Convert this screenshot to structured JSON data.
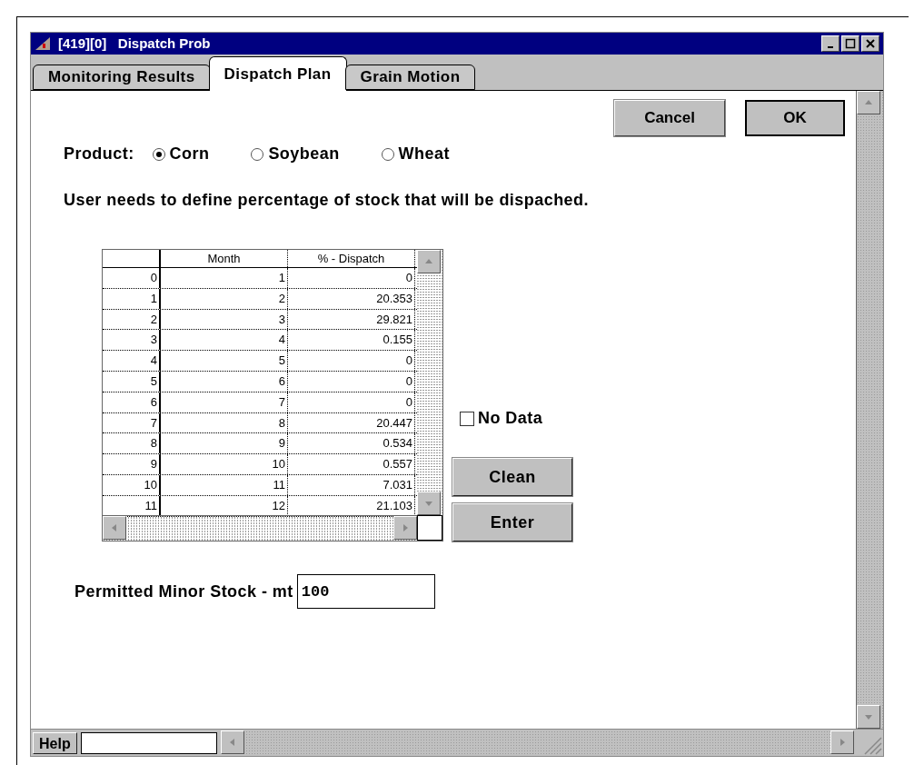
{
  "window": {
    "title": "[419][0]   Dispatch Prob"
  },
  "tabs": [
    {
      "label": "Monitoring Results",
      "selected": false
    },
    {
      "label": "Dispatch Plan",
      "selected": true
    },
    {
      "label": "Grain Motion",
      "selected": false
    }
  ],
  "top_buttons": [
    {
      "label": "Cancel",
      "default": false
    },
    {
      "label": "OK",
      "default": true
    }
  ],
  "product": {
    "label": "Product:",
    "options": [
      {
        "label": "Corn",
        "selected": true
      },
      {
        "label": "Soybean",
        "selected": false
      },
      {
        "label": "Wheat",
        "selected": false
      }
    ]
  },
  "instructions": "User needs to define percentage of stock that will be dispached.",
  "table": {
    "columns": [
      "Month",
      "% - Dispatch"
    ],
    "rows": [
      {
        "index": "0",
        "month": "1",
        "dispatch": "0"
      },
      {
        "index": "1",
        "month": "2",
        "dispatch": "20.353"
      },
      {
        "index": "2",
        "month": "3",
        "dispatch": "29.821"
      },
      {
        "index": "3",
        "month": "4",
        "dispatch": "0.155"
      },
      {
        "index": "4",
        "month": "5",
        "dispatch": "0"
      },
      {
        "index": "5",
        "month": "6",
        "dispatch": "0"
      },
      {
        "index": "6",
        "month": "7",
        "dispatch": "0"
      },
      {
        "index": "7",
        "month": "8",
        "dispatch": "20.447"
      },
      {
        "index": "8",
        "month": "9",
        "dispatch": "0.534"
      },
      {
        "index": "9",
        "month": "10",
        "dispatch": "0.557"
      },
      {
        "index": "10",
        "month": "11",
        "dispatch": "7.031"
      },
      {
        "index": "11",
        "month": "12",
        "dispatch": "21.103"
      }
    ]
  },
  "no_data": {
    "label": "No Data",
    "checked": false
  },
  "side_buttons": [
    "Clean",
    "Enter"
  ],
  "stock_field": {
    "label": "Permitted Minor Stock - mt",
    "value": "100"
  },
  "status_bar": {
    "help": "Help"
  }
}
